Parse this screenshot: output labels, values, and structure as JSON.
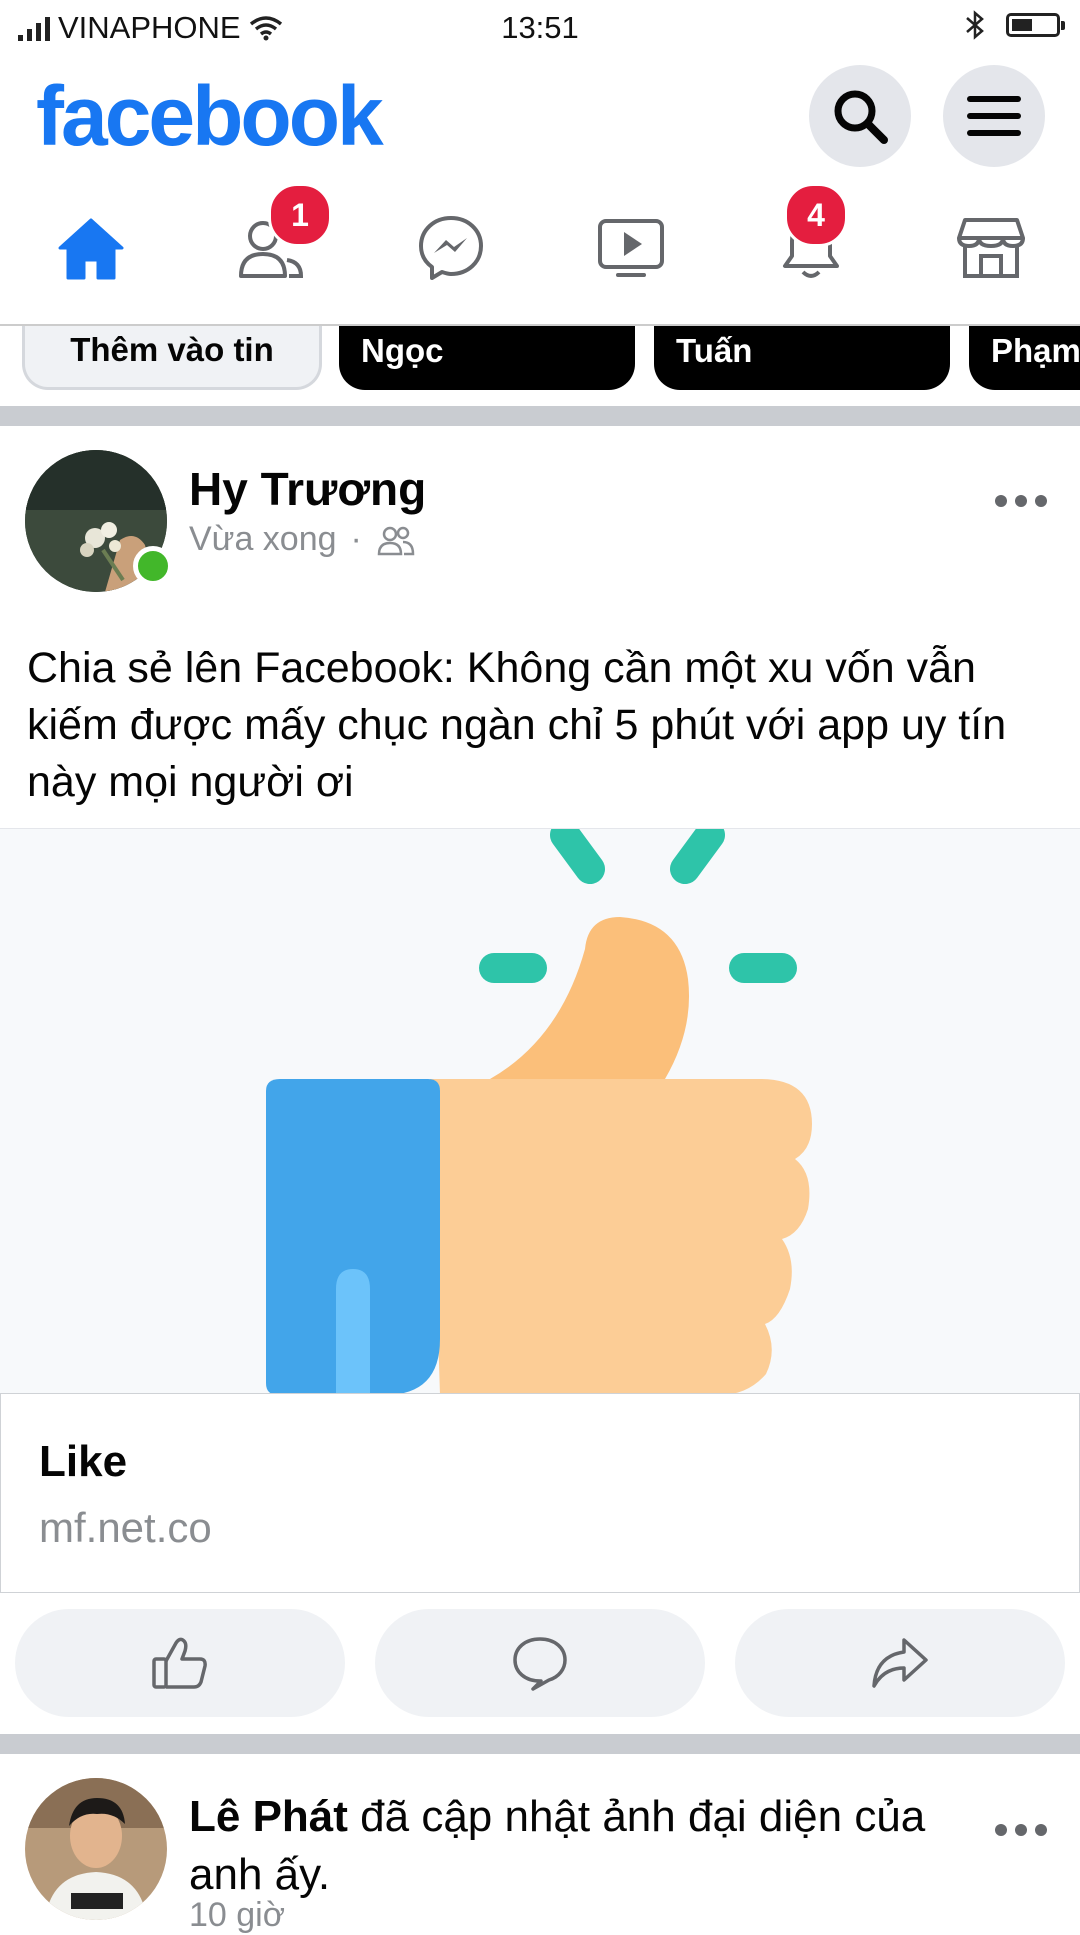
{
  "status_bar": {
    "carrier": "VINAPHONE",
    "time": "13:51"
  },
  "header": {
    "logo_text": "facebook",
    "brand_color": "#1877f2"
  },
  "nav": {
    "items": [
      {
        "icon": "home-icon",
        "active": true
      },
      {
        "icon": "friends-icon",
        "badge": "1"
      },
      {
        "icon": "messenger-icon"
      },
      {
        "icon": "watch-icon"
      },
      {
        "icon": "bell-icon",
        "badge": "4"
      },
      {
        "icon": "marketplace-icon"
      }
    ]
  },
  "stories": [
    {
      "label": "Thêm vào tin"
    },
    {
      "label": "Ngọc"
    },
    {
      "label": "Tuấn"
    },
    {
      "label": "Phạm"
    }
  ],
  "post": {
    "author": "Hy Trương",
    "time": "Vừa xong",
    "privacy_icon": "friends-icon",
    "text": "Chia sẻ lên Facebook: Không cần một xu vốn vẫn kiếm được mấy chục ngàn chỉ 5 phút với app uy tín này mọi người ơi",
    "link_title": "Like",
    "link_domain": "mf.net.co",
    "online_color": "#42b72a"
  },
  "post_actions": [
    {
      "icon": "like-icon"
    },
    {
      "icon": "comment-icon"
    },
    {
      "icon": "share-icon"
    }
  ],
  "post2": {
    "author": "Lê Phát",
    "action_text": " đã cập nhật ảnh đại diện của anh ấy.",
    "time": "10 giờ"
  }
}
